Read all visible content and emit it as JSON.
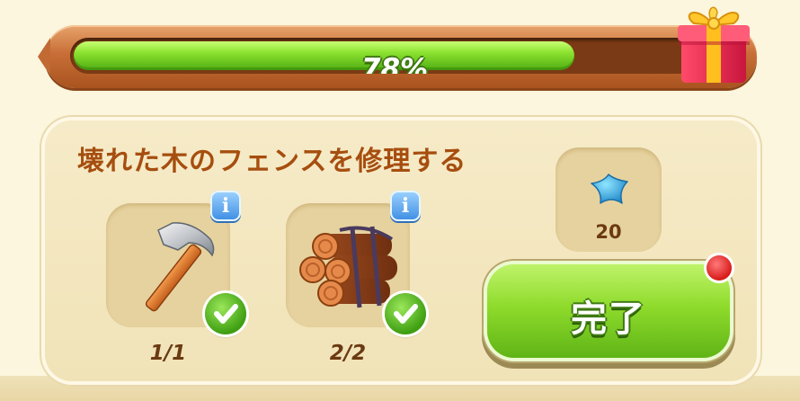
{
  "progress": {
    "percent_label": "78%",
    "fraction": 0.78
  },
  "task": {
    "title": "壊れた木のフェンスを修理する",
    "items": [
      {
        "name": "hammer",
        "icon": "hammer-icon",
        "count": "1/1",
        "complete": true
      },
      {
        "name": "logs",
        "icon": "wood-logs-icon",
        "count": "2/2",
        "complete": true
      }
    ],
    "info_glyph": "i",
    "reward": {
      "icon": "blue-star-icon",
      "amount": "20"
    },
    "complete_button_label": "完了"
  },
  "colors": {
    "title": "#a64e0f",
    "progress_fill": "#8be12f",
    "button_green": "#8fdb2c",
    "info_blue": "#3c8de3",
    "notify_red": "#d81b1b"
  }
}
